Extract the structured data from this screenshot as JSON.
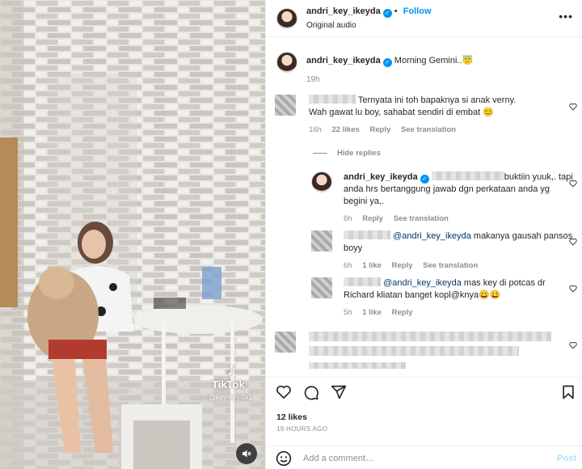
{
  "post": {
    "username": "andri_key_ikeyda",
    "follow_label": "Follow",
    "audio": "Original audio",
    "caption_user": "andri_key_ikeyda",
    "caption_text": "Morning Gemini..😇",
    "caption_time": "19h"
  },
  "media": {
    "watermark_brand": "TikTok",
    "watermark_handle": "@keyikeyda1"
  },
  "comments": [
    {
      "text": "Ternyata ini toh bapaknya si anak verny. Wah gawat lu boy, sahabat sendiri di embat 😊",
      "time": "16h",
      "likes": "22 likes",
      "reply": "Reply",
      "translate": "See translation"
    }
  ],
  "hide_replies": "Hide replies",
  "replies": [
    {
      "username": "andri_key_ikeyda",
      "text": "buktiin yuuk,. tapi anda hrs bertanggung jawab dgn perkataan anda yg begini ya,.",
      "time": "6h",
      "reply": "Reply",
      "translate": "See translation"
    },
    {
      "mention": "@andri_key_ikeyda",
      "text": " makanya gausah pansos boyy",
      "time": "6h",
      "likes": "1 like",
      "reply": "Reply",
      "translate": "See translation"
    },
    {
      "mention": "@andri_key_ikeyda",
      "text": " mas key di potcas dr Richard kliatan banget kopl@knya😀😀",
      "time": "5h",
      "likes": "1 like",
      "reply": "Reply"
    }
  ],
  "footer": {
    "likes": "12 likes",
    "ago": "19 HOURS AGO",
    "add_comment_placeholder": "Add a comment…",
    "post_label": "Post"
  },
  "icons": [
    "more-icon",
    "heart-icon",
    "comment-icon",
    "share-icon",
    "bookmark-icon",
    "emoji-icon",
    "mute-icon",
    "verified-icon"
  ]
}
